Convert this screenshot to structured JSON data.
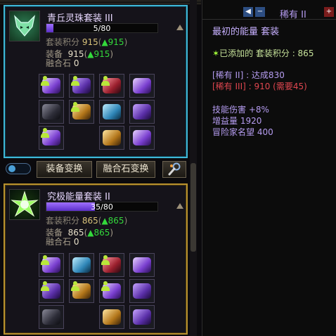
{
  "sets": [
    {
      "name": "青丘灵珠套装 III",
      "progress_text": "5/80",
      "progress_fraction": 0.0625,
      "points_label": "套装积分",
      "points_value": "915",
      "points_bonus": "▲915",
      "equip_label": "装备",
      "equip_value": "915",
      "equip_bonus": "▲915",
      "stone_label": "融合石",
      "stone_value": "0",
      "icon": "fox-head-icon"
    },
    {
      "name": "究极能量套装 II",
      "progress_text": "35/80",
      "progress_fraction": 0.4375,
      "points_label": "套装积分",
      "points_value": "865",
      "points_bonus": "▲865",
      "equip_label": "装备",
      "equip_value": "865",
      "equip_bonus": "▲865",
      "stone_label": "融合石",
      "stone_value": "0",
      "icon": "energy-burst-icon"
    }
  ],
  "toolbar": {
    "equip_switch": "装备变换",
    "stone_switch": "融合石变换"
  },
  "tooltip": {
    "rarity": "稀有 II",
    "set_name": "最初的能量 套装",
    "added_label": "已添加的 套装积分 : 865",
    "tier1": "[稀有 II] : 达成830",
    "tier2": "[稀有 III] : 910 (需要45)",
    "effects": [
      "技能伤害 +8%",
      "增益量 1920",
      "冒险家名望 400"
    ]
  },
  "colors": {
    "selected_border": "#3fb7d6",
    "normal_border": "#b8912e",
    "progress_fill": "#7a48e8",
    "bonus_green": "#33d93b",
    "rarity_purple": "#b59cf0",
    "requirement_red": "#e0464f"
  }
}
